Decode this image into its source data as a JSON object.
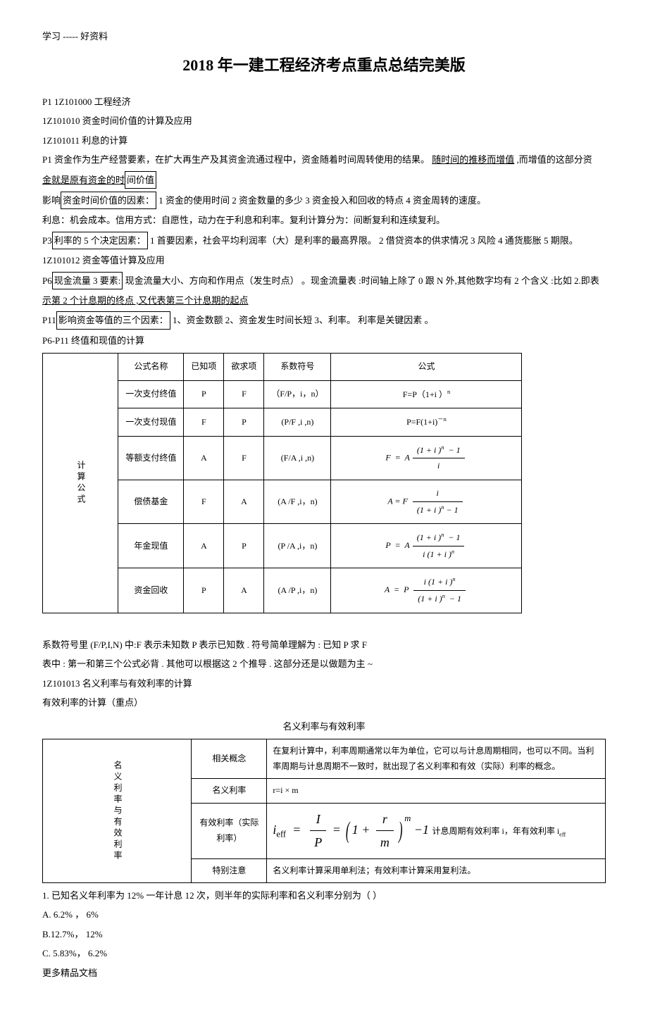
{
  "header": "学习 ----- 好资料",
  "title": "2018  年一建工程经济考点重点总结完美版",
  "p_lines": {
    "l1": "P1 1Z101000   工程经济",
    "l2": "1Z101010   资金时间价值的计算及应用",
    "l3": "1Z101011   利息的计算",
    "l4a": "P1 资金作为生产经营要素，在扩大再生产及其资金流通过程中，资金随着时间周转使用的结果。",
    "l4b": "随时间的推移而增值",
    "l4c": " ,而增值的这部分资",
    "l5a": "金就是原有资金的时",
    "l5b": "间价值",
    "l6a": "影响",
    "l6b": "资金时间价值的因素：",
    "l6c": "  1 资金的使用时间   2 资金数量的多少   3 资金投入和回收的特点   4 资金周转的速度。",
    "l7": "利息：机会成本。信用方式：自愿性，动力在于利息和利率。复利计算分为：间断复利和连续复利。",
    "l8a": "P3",
    "l8b": "利率的 5 个决定因素：",
    "l8c": "  1 首要因素，社会平均利润率（大）是利率的最高界限。       2 借贷资本的供求情况   3 风险 4 通货膨胀  5 期限。",
    "l9": "1Z101012   资金等值计算及应用",
    "l10a": "P6",
    "l10b": "现金流量 3 要素:",
    "l10c": " 现金流量大小、方向和作用点（发生时点）     。现金流量表 :时间轴上除了  0 跟 N 外,其他数字均有  2 个含义 :比如 2.即表",
    "l10d": "示第 2 个计息期的终点 ,又代表第三个计息期的起点",
    "l11a": "P11",
    "l11b": "影响资金等值的三个因素：",
    "l11c": "  1、资金数额  2、资金发生时间长短   3、利率。 利率是关键因素 。",
    "l12": "P6-P11 终值和现值的计算"
  },
  "tbl1": {
    "side": "计算公式",
    "h1": "公式名称",
    "h2": "已知项",
    "h3": "欲求项",
    "h4": "系数符号",
    "h5": "公式",
    "rows": [
      {
        "name": "一次支付终值",
        "known": "P",
        "want": "F",
        "sym": "（F/P，i，n）",
        "f_txt": "F=P（1+i  ）",
        "f_sup": "n"
      },
      {
        "name": "一次支付现值",
        "known": "F",
        "want": "P",
        "sym": "(P/F ,i ,n)",
        "f_txt": "P=F(1+i)",
        "f_sup": "－n"
      },
      {
        "name": "等额支付终值",
        "known": "A",
        "want": "F",
        "sym": "(F/A ,i ,n)"
      },
      {
        "name": "偿债基金",
        "known": "F",
        "want": "A",
        "sym": "(A /F  ,i，n)"
      },
      {
        "name": "年金现值",
        "known": "A",
        "want": "P",
        "sym": "(P /A  ,i，n)"
      },
      {
        "name": "资金回收",
        "known": "P",
        "want": "A",
        "sym": "(A /P  ,i，n)"
      }
    ]
  },
  "mid_lines": {
    "m1": "系数符号里  (F/P,I,N)    中:F 表示未知数  P 表示已知数 . 符号简单理解为 : 已知 P 求 F",
    "m2": "表中 : 第一和第三个公式必背   . 其他可以根据这   2 个推导 . 这部分还是以做题为主   ~",
    "m3": "1Z101013   名义利率与有效利率的计算",
    "m4": "有效利率的计算（重点）",
    "sub": "名义利率与有效利率"
  },
  "tbl2": {
    "side": "名义利率与有效利率",
    "r1a": "相关概念",
    "r1b": "在复利计算中，利率周期通常以年为单位，它可以与计息周期相同，也可以不同。当利率周期与计息周期不一致时，就出现了名义利率和有效（实际）利率的概念。",
    "r2a": "名义利率",
    "r2b": "r=i × m",
    "r3a": "有效利率（实际利率）",
    "r3b_tail": "       计息周期有效利率   i，年有效利率  i",
    "r3b_sub": "eff",
    "r4a": "特别注意",
    "r4b": "名义利率计算采用单利法；有效利率计算采用复利法。"
  },
  "q": {
    "q1": "1.  已知名义年利率为   12%  一年计息  12 次，则半年的实际利率和名义利率分别为（        ）",
    "a": "A. 6.2% ， 6%",
    "b": "B.12.7%， 12%",
    "c": "C. 5.83%，  6.2%"
  },
  "footer": "更多精品文档"
}
